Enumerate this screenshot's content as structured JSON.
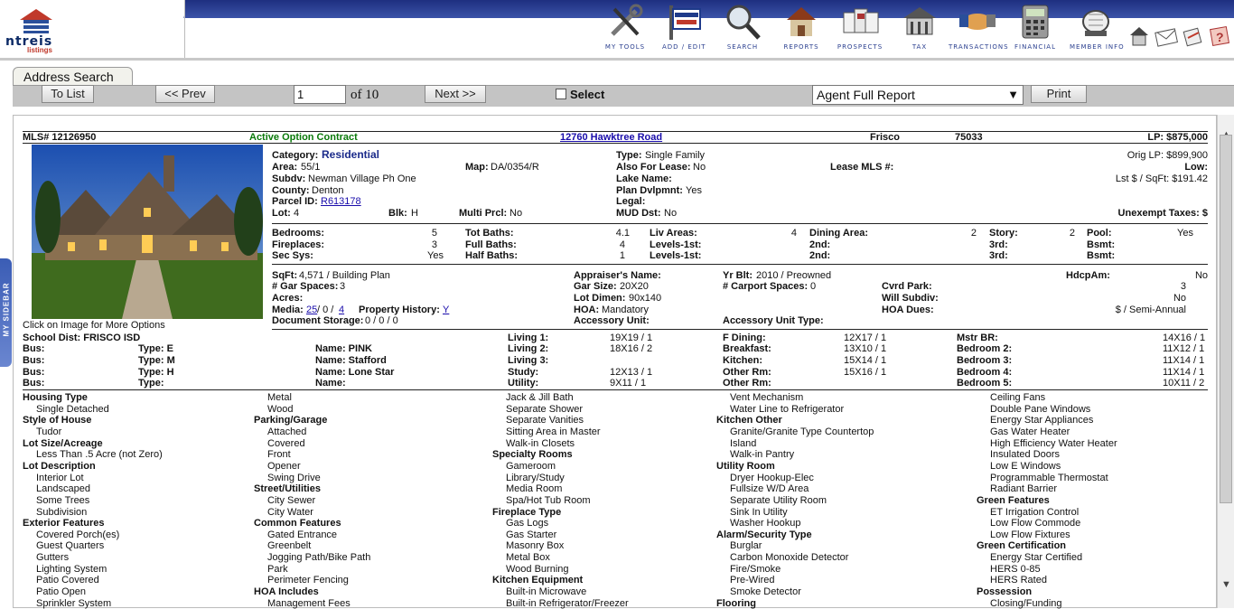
{
  "brand": {
    "name": "ntreis",
    "sub": "listings"
  },
  "nav": [
    {
      "label": "MY TOOLS",
      "icon": "tools-icon"
    },
    {
      "label": "ADD / EDIT",
      "icon": "sign-icon"
    },
    {
      "label": "SEARCH",
      "icon": "magnifier-icon"
    },
    {
      "label": "REPORTS",
      "icon": "reports-icon"
    },
    {
      "label": "PROSPECTS",
      "icon": "prospects-icon"
    },
    {
      "label": "TAX",
      "icon": "tax-icon"
    },
    {
      "label": "TRANSACTIONS",
      "icon": "handshake-icon"
    },
    {
      "label": "FINANCIAL",
      "icon": "calculator-icon"
    },
    {
      "label": "MEMBER INFO",
      "icon": "rolodex-icon"
    }
  ],
  "tab": "Address Search",
  "toolbar": {
    "to_list": "To List",
    "prev": "<< Prev",
    "page": "1",
    "of": "of 10",
    "next": "Next >>",
    "select": "Select",
    "report": "Agent Full Report",
    "print": "Print"
  },
  "sidebar_label": "MY SIDEBAR",
  "photo_caption": "Click on Image for More Options",
  "header": {
    "mls": "MLS# 12126950",
    "status": "Active Option Contract",
    "address": "12760 Hawktree Road",
    "city": "Frisco",
    "zip": "75033",
    "lp": "LP: $875,000"
  },
  "left_pairs": [
    {
      "k": "Category:",
      "v": "Residential"
    },
    {
      "k": "Area:",
      "v": "55/1"
    },
    {
      "k": "Subdv:",
      "v": "Newman Village Ph One"
    },
    {
      "k": "County:",
      "v": "Denton"
    },
    {
      "k": "Parcel ID:",
      "v": "R613178"
    },
    {
      "k": "Lot:",
      "v": "4"
    }
  ],
  "misc": {
    "blk_k": "Blk:",
    "blk_v": "H",
    "map_k": "Map:",
    "map_v": "DA/0354/R",
    "multi_k": "Multi Prcl:",
    "multi_v": "No",
    "type_k": "Type:",
    "type_v": "Single Family",
    "lease_k": "Also For Lease:",
    "lease_v": "No",
    "lake_k": "Lake Name:",
    "plan_k": "Plan Dvlpmnt:",
    "plan_v": "Yes",
    "legal_k": "Legal:",
    "mud_k": "MUD Dst:",
    "mud_v": "No",
    "leasemls_k": "Lease MLS #:",
    "origlp": "Orig LP: $899,900",
    "low": "Low:",
    "lst": "Lst $ / SqFt: $191.42",
    "unexempt": "Unexempt Taxes: $"
  },
  "rooms": {
    "bedrooms_k": "Bedrooms:",
    "bedrooms_v": "5",
    "fire_k": "Fireplaces:",
    "fire_v": "3",
    "sec_k": "Sec Sys:",
    "sec_v": "Yes",
    "tot_k": "Tot Baths:",
    "tot_v": "4.1",
    "full_k": "Full Baths:",
    "full_v": "4",
    "half_k": "Half Baths:",
    "half_v": "1",
    "liv_k": "Liv Areas:",
    "liv_v": "4",
    "lev1_k": "Levels-1st:",
    "lev2_k": "Levels-1st:",
    "din_k": "Dining Area:",
    "din_v": "2",
    "2nd_a": "2nd:",
    "2nd_b": "2nd:",
    "story_k": "Story:",
    "story_v": "2",
    "3rd_a": "3rd:",
    "3rd_b": "3rd:",
    "pool_k": "Pool:",
    "pool_v": "Yes",
    "bsmt_a": "Bsmt:",
    "bsmt_b": "Bsmt:"
  },
  "details": {
    "sqft_k": "SqFt:",
    "sqft_v": "4,571 / Building Plan",
    "gar_k": "# Gar Spaces:",
    "gar_v": "3",
    "acres_k": "Acres:",
    "media_k": "Media:",
    "media_a": "25",
    "media_b": " / 0 / ",
    "media_c": "4",
    "hist_k": "Property History:",
    "hist_v": "Y",
    "doc_k": "Document Storage:",
    "doc_v": "0 / 0 / 0",
    "appr_k": "Appraiser's Name:",
    "gsize_k": "Gar Size:",
    "gsize_v": "20X20",
    "dimen_k": "Lot Dimen:",
    "dimen_v": "90x140",
    "hoa_k": "HOA:",
    "hoa_v": "Mandatory",
    "acc_k": "Accessory Unit:",
    "yr_k": "Yr Blt:",
    "yr_v": "2010 / Preowned",
    "carport_k": "# Carport Spaces:",
    "carport_v": "0",
    "accut_k": "Accessory Unit Type:",
    "cvrd_k": "Cvrd Park:",
    "cvrd_v": "3",
    "subdiv_k": "Will Subdiv:",
    "subdiv_v": "No",
    "hoadues_k": "HOA Dues:",
    "hoadues_v": "$ / Semi-Annual",
    "hdcp_k": "HdcpAm:",
    "hdcp_v": "No"
  },
  "school": {
    "dist": "School Dist: FRISCO ISD",
    "bus": [
      "Bus:",
      "Bus:",
      "Bus:",
      "Bus:"
    ],
    "types": [
      "Type: E",
      "Type: M",
      "Type: H",
      "Type:"
    ],
    "names": [
      "Name: PINK",
      "Name: Stafford",
      "Name: Lone Star",
      "Name:"
    ]
  },
  "room_dims": [
    {
      "k": "Living 1:",
      "v": "19X19  / 1"
    },
    {
      "k": "Living 2:",
      "v": "18X16  / 2"
    },
    {
      "k": "Living 3:",
      "v": ""
    },
    {
      "k": "Study:",
      "v": "12X13  / 1"
    },
    {
      "k": "Utility:",
      "v": "9X11  / 1"
    },
    {
      "k": "F Dining:",
      "v": "12X17  / 1"
    },
    {
      "k": "Breakfast:",
      "v": "13X10  / 1"
    },
    {
      "k": "Kitchen:",
      "v": "15X14  / 1"
    },
    {
      "k": "Other Rm:",
      "v": "15X16  / 1"
    },
    {
      "k": "Other Rm:",
      "v": ""
    },
    {
      "k": "Mstr BR:",
      "v": "14X16  / 1"
    },
    {
      "k": "Bedroom 2:",
      "v": "11X12  / 1"
    },
    {
      "k": "Bedroom 3:",
      "v": "11X14  / 1"
    },
    {
      "k": "Bedroom 4:",
      "v": "11X14  / 1"
    },
    {
      "k": "Bedroom 5:",
      "v": "10X11  / 2"
    }
  ],
  "features": [
    [
      {
        "h": 1,
        "t": "Housing Type"
      },
      {
        "t": "Single Detached"
      },
      {
        "h": 1,
        "t": "Style of House"
      },
      {
        "t": "Tudor"
      },
      {
        "h": 1,
        "t": "Lot Size/Acreage"
      },
      {
        "t": "Less Than .5 Acre (not Zero)"
      },
      {
        "h": 1,
        "t": "Lot Description"
      },
      {
        "t": "Interior Lot"
      },
      {
        "t": "Landscaped"
      },
      {
        "t": "Some Trees"
      },
      {
        "t": "Subdivision"
      },
      {
        "h": 1,
        "t": "Exterior Features"
      },
      {
        "t": "Covered Porch(es)"
      },
      {
        "t": "Guest Quarters"
      },
      {
        "t": "Gutters"
      },
      {
        "t": "Lighting System"
      },
      {
        "t": "Patio Covered"
      },
      {
        "t": "Patio Open"
      },
      {
        "t": "Sprinkler System"
      }
    ],
    [
      {
        "t": "Metal"
      },
      {
        "t": "Wood"
      },
      {
        "h": 1,
        "t": "Parking/Garage"
      },
      {
        "t": "Attached"
      },
      {
        "t": "Covered"
      },
      {
        "t": "Front"
      },
      {
        "t": "Opener"
      },
      {
        "t": "Swing Drive"
      },
      {
        "h": 1,
        "t": "Street/Utilities"
      },
      {
        "t": "City Sewer"
      },
      {
        "t": "City Water"
      },
      {
        "h": 1,
        "t": "Common Features"
      },
      {
        "t": "Gated Entrance"
      },
      {
        "t": "Greenbelt"
      },
      {
        "t": "Jogging Path/Bike Path"
      },
      {
        "t": "Park"
      },
      {
        "t": "Perimeter Fencing"
      },
      {
        "h": 1,
        "t": "HOA Includes"
      },
      {
        "t": "Management Fees"
      }
    ],
    [
      {
        "t": "Jack & Jill Bath"
      },
      {
        "t": "Separate Shower"
      },
      {
        "t": "Separate Vanities"
      },
      {
        "t": "Sitting Area in Master"
      },
      {
        "t": "Walk-in Closets"
      },
      {
        "h": 1,
        "t": "Specialty Rooms"
      },
      {
        "t": "Gameroom"
      },
      {
        "t": "Library/Study"
      },
      {
        "t": "Media Room"
      },
      {
        "t": "Spa/Hot Tub Room"
      },
      {
        "h": 1,
        "t": "Fireplace Type"
      },
      {
        "t": "Gas Logs"
      },
      {
        "t": "Gas Starter"
      },
      {
        "t": "Masonry Box"
      },
      {
        "t": "Metal Box"
      },
      {
        "t": "Wood Burning"
      },
      {
        "h": 1,
        "t": "Kitchen Equipment"
      },
      {
        "t": "Built-in Microwave"
      },
      {
        "t": "Built-in Refrigerator/Freezer"
      }
    ],
    [
      {
        "t": "Vent Mechanism"
      },
      {
        "t": "Water Line to Refrigerator"
      },
      {
        "h": 1,
        "t": "Kitchen Other"
      },
      {
        "t": "Granite/Granite Type Countertop"
      },
      {
        "t": "Island"
      },
      {
        "t": "Walk-in Pantry"
      },
      {
        "h": 1,
        "t": "Utility Room"
      },
      {
        "t": "Dryer Hookup-Elec"
      },
      {
        "t": "Fullsize W/D Area"
      },
      {
        "t": "Separate Utility Room"
      },
      {
        "t": "Sink In Utility"
      },
      {
        "t": "Washer Hookup"
      },
      {
        "h": 1,
        "t": "Alarm/Security Type"
      },
      {
        "t": "Burglar"
      },
      {
        "t": "Carbon Monoxide Detector"
      },
      {
        "t": "Fire/Smoke"
      },
      {
        "t": "Pre-Wired"
      },
      {
        "t": "Smoke Detector"
      },
      {
        "h": 1,
        "t": "Flooring"
      }
    ],
    [
      {
        "t": "Ceiling Fans"
      },
      {
        "t": "Double Pane Windows"
      },
      {
        "t": "Energy Star Appliances"
      },
      {
        "t": "Gas Water Heater"
      },
      {
        "t": "High Efficiency Water Heater"
      },
      {
        "t": "Insulated Doors"
      },
      {
        "t": "Low E Windows"
      },
      {
        "t": "Programmable Thermostat"
      },
      {
        "t": "Radiant Barrier"
      },
      {
        "h": 1,
        "t": "Green Features"
      },
      {
        "t": "ET Irrigation Control"
      },
      {
        "t": "Low Flow Commode"
      },
      {
        "t": "Low Flow Fixtures"
      },
      {
        "h": 1,
        "t": "Green Certification"
      },
      {
        "t": "Energy Star Certified"
      },
      {
        "t": "HERS 0-85"
      },
      {
        "t": "HERS Rated"
      },
      {
        "h": 1,
        "t": "Possession"
      },
      {
        "t": "Closing/Funding"
      }
    ]
  ]
}
